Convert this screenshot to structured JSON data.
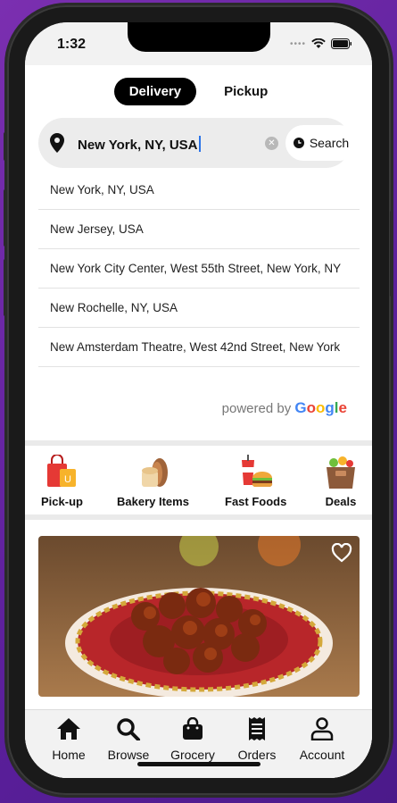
{
  "status": {
    "time": "1:32"
  },
  "mode": {
    "delivery": "Delivery",
    "pickup": "Pickup"
  },
  "search": {
    "value": "New York, NY, USA",
    "button": "Search"
  },
  "suggestions": [
    "New York, NY, USA",
    "New Jersey, USA",
    "New York City Center, West 55th Street, New York, NY",
    "New Rochelle, NY, USA",
    "New Amsterdam Theatre, West 42nd Street, New York"
  ],
  "powered": {
    "prefix": "powered by",
    "brand": "Google"
  },
  "categories": [
    {
      "label": "Pick-up",
      "icon": "shopping-bags-icon"
    },
    {
      "label": "Bakery Items",
      "icon": "bread-icon"
    },
    {
      "label": "Fast Foods",
      "icon": "burger-drink-icon"
    },
    {
      "label": "Deals",
      "icon": "grocery-bag-icon"
    }
  ],
  "tabs": [
    {
      "label": "Home",
      "icon": "home-icon"
    },
    {
      "label": "Browse",
      "icon": "search-icon"
    },
    {
      "label": "Grocery",
      "icon": "bag-icon"
    },
    {
      "label": "Orders",
      "icon": "receipt-icon"
    },
    {
      "label": "Account",
      "icon": "person-icon"
    }
  ],
  "colors": {
    "accent": "#000000",
    "caret": "#2a73e8",
    "background": "#7b2fb0"
  }
}
